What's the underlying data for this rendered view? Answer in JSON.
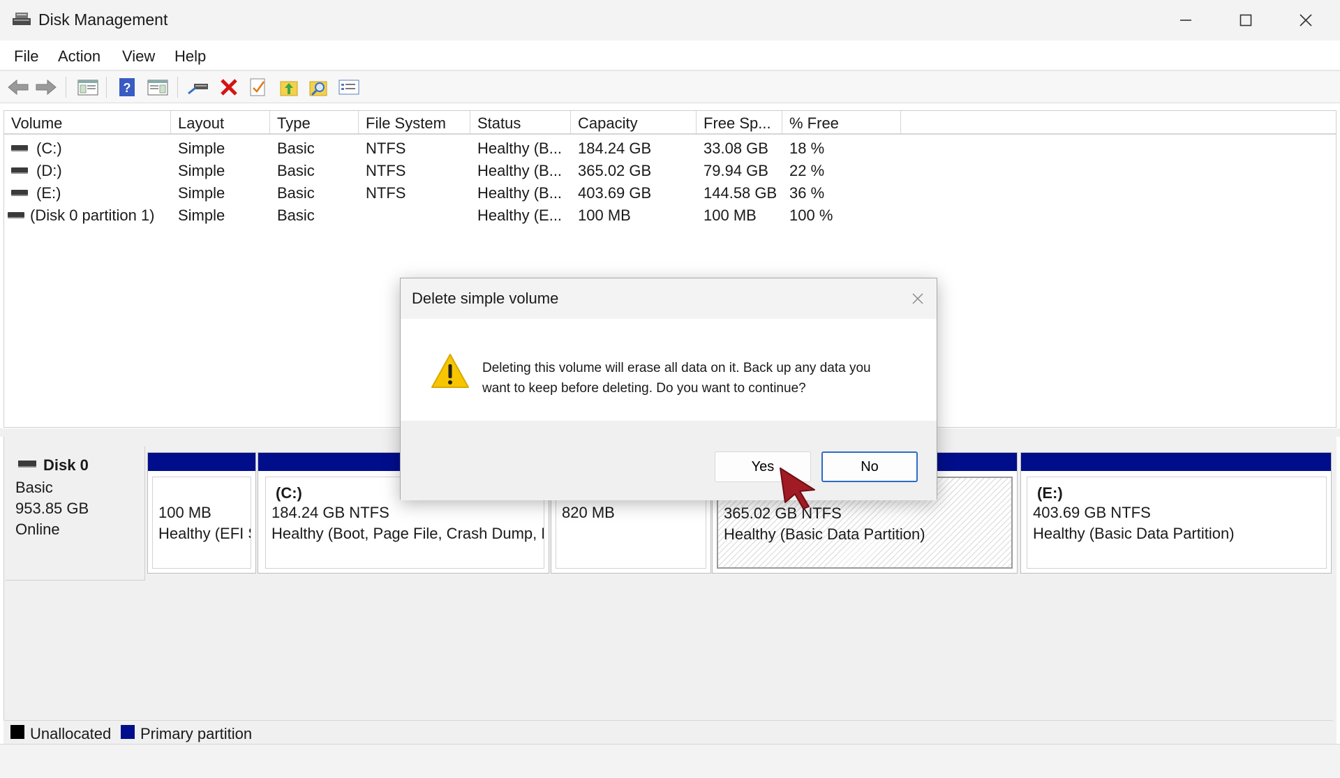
{
  "window": {
    "title": "Disk Management",
    "icon": "disk-management-icon"
  },
  "menu": [
    "File",
    "Action",
    "View",
    "Help"
  ],
  "toolbar": {
    "icons": [
      "back-icon",
      "forward-icon",
      "console-tree-icon",
      "help-icon",
      "action-pane-icon",
      "connect-disk-icon",
      "delete-icon",
      "properties-icon",
      "import-icon",
      "rescan-icon",
      "list-view-icon"
    ]
  },
  "volume_list": {
    "columns": [
      "Volume",
      "Layout",
      "Type",
      "File System",
      "Status",
      "Capacity",
      "Free Sp...",
      "% Free"
    ],
    "rows": [
      {
        "volume": "(C:)",
        "layout": "Simple",
        "type": "Basic",
        "fs": "NTFS",
        "status": "Healthy (B...",
        "capacity": "184.24 GB",
        "free": "33.08 GB",
        "pct": "18 %"
      },
      {
        "volume": "(D:)",
        "layout": "Simple",
        "type": "Basic",
        "fs": "NTFS",
        "status": "Healthy (B...",
        "capacity": "365.02 GB",
        "free": "79.94 GB",
        "pct": "22 %"
      },
      {
        "volume": "(E:)",
        "layout": "Simple",
        "type": "Basic",
        "fs": "NTFS",
        "status": "Healthy (B...",
        "capacity": "403.69 GB",
        "free": "144.58 GB",
        "pct": "36 %"
      },
      {
        "volume": "(Disk 0 partition 1)",
        "layout": "Simple",
        "type": "Basic",
        "fs": "",
        "status": "Healthy (E...",
        "capacity": "100 MB",
        "free": "100 MB",
        "pct": "100 %"
      }
    ]
  },
  "disk": {
    "name": "Disk 0",
    "type": "Basic",
    "size": "953.85 GB",
    "state": "Online",
    "partitions": [
      {
        "name": "",
        "size": "100 MB",
        "status": "Healthy (EFI S"
      },
      {
        "name": "(C:)",
        "size": "184.24 GB NTFS",
        "status": "Healthy (Boot, Page File, Crash Dump, B"
      },
      {
        "name": "",
        "size": "820 MB",
        "status": ""
      },
      {
        "name": "",
        "size": "365.02 GB NTFS",
        "status": "Healthy (Basic Data Partition)"
      },
      {
        "name": "(E:)",
        "size": "403.69 GB NTFS",
        "status": "Healthy (Basic Data Partition)"
      }
    ]
  },
  "legend": {
    "unallocated": "Unallocated",
    "primary": "Primary partition",
    "unallocated_color": "#000000",
    "primary_color": "#000e8c"
  },
  "dialog": {
    "title": "Delete simple volume",
    "message": "Deleting this volume will erase all data on it. Back up any data you want to keep before deleting. Do you want to continue?",
    "yes_label": "Yes",
    "no_label": "No",
    "icon": "warning-icon"
  }
}
